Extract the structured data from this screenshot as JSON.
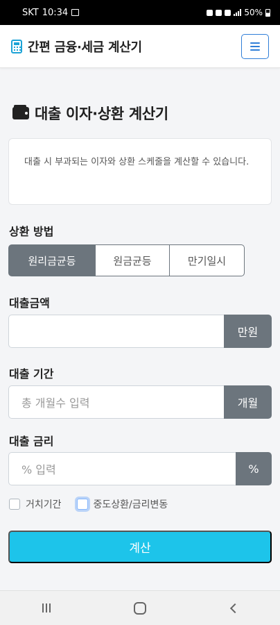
{
  "status_bar": {
    "carrier": "SKT",
    "time": "10:34",
    "battery": "50%"
  },
  "header": {
    "app_title": "간편 금융·세금 계산기",
    "brand_icon": "calculator-icon",
    "menu_icon": "hamburger-icon",
    "accent_color": "#1ca3d6"
  },
  "page": {
    "title": "대출 이자·상환 계산기",
    "title_icon": "wallet-icon",
    "description": "대출 시 부과되는 이자와 상환 스케줄을 계산할 수 있습니다."
  },
  "form": {
    "repayment_method": {
      "label": "상환 방법",
      "options": [
        "원리금균등",
        "원금균등",
        "만기일시"
      ],
      "selected": "원리금균등"
    },
    "loan_amount": {
      "label": "대출금액",
      "value": "",
      "placeholder": "",
      "unit": "만원"
    },
    "loan_period": {
      "label": "대출 기간",
      "placeholder": "총 개월수 입력",
      "unit": "개월"
    },
    "interest_rate": {
      "label": "대출 금리",
      "placeholder": "% 입력",
      "unit": "%"
    },
    "options": {
      "grace_period": {
        "label": "거치기간",
        "checked": false
      },
      "prepayment": {
        "label": "중도상환/금리변동",
        "checked": false
      }
    },
    "submit_label": "계산",
    "submit_color": "#1dc4ea"
  },
  "system_nav": {
    "recents_icon": "recents-icon",
    "home_icon": "home-icon",
    "back_icon": "back-icon"
  }
}
